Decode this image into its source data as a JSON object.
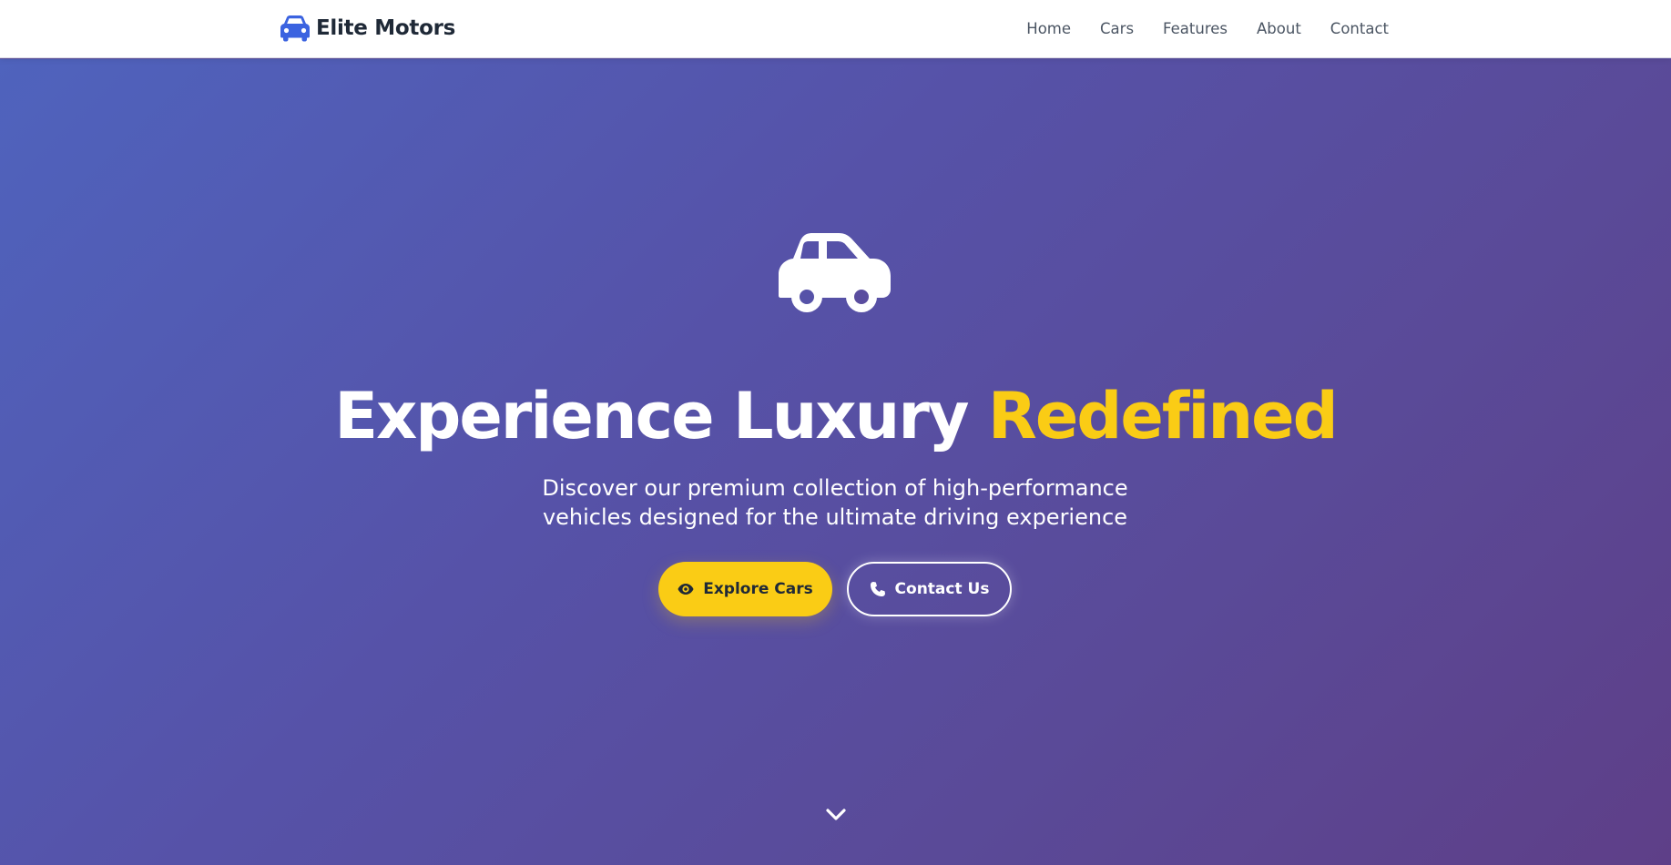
{
  "nav": {
    "brand_text": "Elite Motors",
    "brand_icon": "car-icon",
    "links": [
      "Home",
      "Cars",
      "Features",
      "About",
      "Contact"
    ]
  },
  "hero": {
    "icon": "car-icon",
    "title_main": "Experience Luxury ",
    "title_accent": "Redefined",
    "subtitle_line1": "Discover our premium collection of high-performance",
    "subtitle_line2": "vehicles designed for the ultimate driving experience",
    "primary_button": {
      "label": "Explore Cars",
      "icon": "eye-icon"
    },
    "secondary_button": {
      "label": "Contact Us",
      "icon": "phone-icon"
    },
    "scroll_icon": "chevron-down-icon"
  },
  "colors": {
    "brand_blue": "#3b63e0",
    "accent_yellow": "#facc15",
    "nav_text": "#4b5563",
    "brand_text": "#1f2937",
    "hero_gradient_start": "#4f63bd",
    "hero_gradient_end": "#5e3f88"
  }
}
